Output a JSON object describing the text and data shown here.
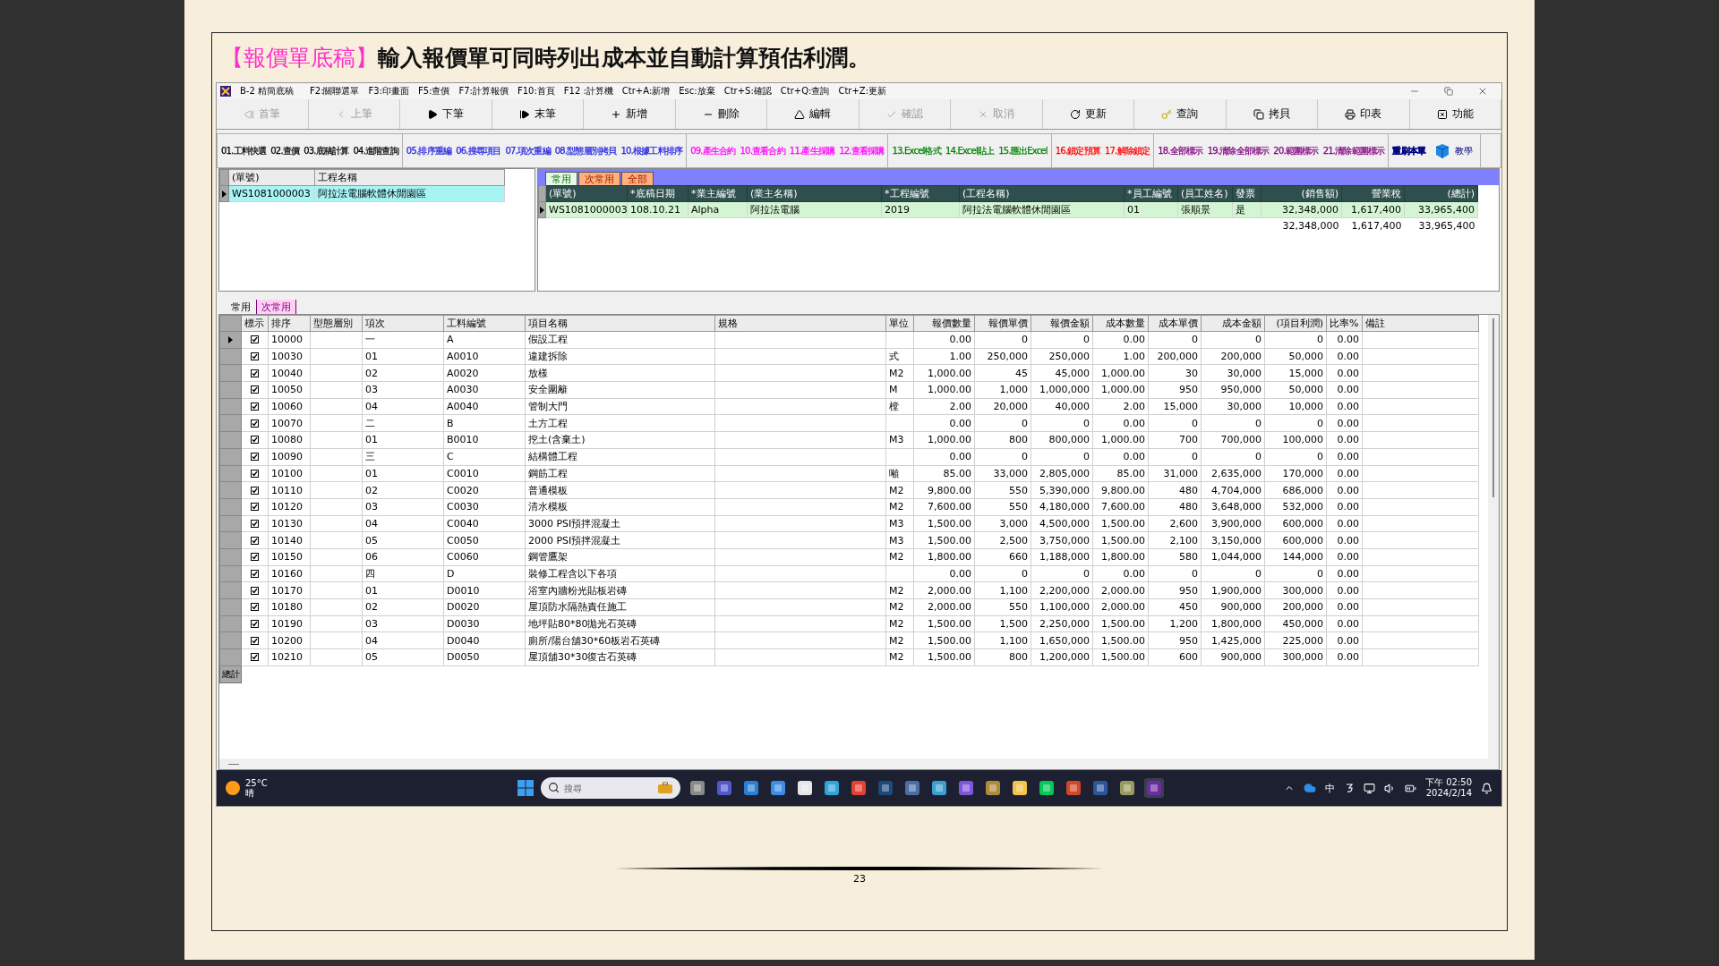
{
  "heading": {
    "tag": "【報價單底稿】",
    "text": "輸入報價單可同時列出成本並自動計算預估利潤。"
  },
  "window": {
    "title": "B-2 精簡底稿",
    "shortcuts": [
      "F2:關聯選單",
      "F3:印畫面",
      "F5:查價",
      "F7:計算報價",
      "F10:首頁",
      "F12 :計算機",
      "Ctr+A:新增",
      "Esc:放棄",
      "Ctr+S:確認",
      "Ctr+Q:查詢",
      "Ctr+Z:更新"
    ]
  },
  "toolbar": [
    {
      "label": "首筆",
      "disabled": true
    },
    {
      "label": "上筆",
      "disabled": true
    },
    {
      "label": "下筆",
      "disabled": false
    },
    {
      "label": "末筆",
      "disabled": false
    },
    {
      "label": "新增",
      "disabled": false
    },
    {
      "label": "刪除",
      "disabled": false
    },
    {
      "label": "編輯",
      "disabled": false
    },
    {
      "label": "確認",
      "disabled": true
    },
    {
      "label": "取消",
      "disabled": true
    },
    {
      "label": "更新",
      "disabled": false
    },
    {
      "label": "查詢",
      "disabled": false
    },
    {
      "label": "拷貝",
      "disabled": false
    },
    {
      "label": "印表",
      "disabled": false
    },
    {
      "label": "功能",
      "disabled": false
    }
  ],
  "function_groups": [
    {
      "color": "#000000",
      "items": [
        "01.工料快選",
        "02.查價",
        "03.底稿計算",
        "04.進階查詢"
      ]
    },
    {
      "color": "#1f1fe0",
      "items": [
        "05.排序重編",
        "06.搜尋項目",
        "07.項次重編",
        "08.型態層別拷貝",
        "10.根據工料排序"
      ]
    },
    {
      "color": "#ff00ff",
      "items": [
        "09.產生合約",
        "10.查看合約",
        "11.產生採購",
        "12.查看採購"
      ]
    },
    {
      "color": "#008000",
      "items": [
        "13.Excel格式",
        "14.Excel貼上",
        "15.匯出Excel"
      ]
    },
    {
      "color": "#ff0000",
      "items": [
        "16.鎖定預算",
        "17.解除鎖定"
      ]
    },
    {
      "color": "#800080",
      "items": [
        "18.全部標示",
        "19.清除全部標示",
        "20.範圍標示",
        "21.清除範圍標示"
      ]
    },
    {
      "color": "#000080",
      "items": [
        "重刷本單"
      ]
    }
  ],
  "tutorial_button": {
    "label": "教學"
  },
  "document_list": {
    "columns": [
      "(單號)",
      "工程名稱"
    ],
    "rows": [
      {
        "selected": true,
        "cells": [
          "WS1081000003",
          "阿拉法電腦軟體休閒園區"
        ]
      }
    ]
  },
  "detail_tabs": [
    {
      "label": "常用",
      "selected": true
    },
    {
      "label": "次常用",
      "selected": false
    },
    {
      "label": "全部",
      "selected": false
    }
  ],
  "detail_table": {
    "columns": [
      "(單號)",
      "*底稿日期",
      "*業主編號",
      "(業主名稱)",
      "*工程編號",
      "(工程名稱)",
      "*員工編號",
      "(員工姓名)",
      "發票",
      "(銷售額)",
      "營業稅",
      "(總計)"
    ],
    "rows": [
      {
        "current": true,
        "cells": [
          "WS1081000003",
          "108.10.21",
          "Alpha",
          "阿拉法電腦",
          "2019",
          "阿拉法電腦軟體休閒園區",
          "01",
          "張順景",
          "是",
          "32,348,000",
          "1,617,400",
          "33,965,400"
        ]
      }
    ],
    "totals": [
      "32,348,000",
      "1,617,400",
      "33,965,400"
    ]
  },
  "grid_tabs": [
    {
      "label": "常用",
      "selected": true
    },
    {
      "label": "次常用",
      "selected": false
    }
  ],
  "items_table": {
    "columns": [
      "標示",
      "排序",
      "型態層別",
      "項次",
      "工料編號",
      "項目名稱",
      "規格",
      "單位",
      "報價數量",
      "報價單價",
      "報價金額",
      "成本數量",
      "成本單價",
      "成本金額",
      "(項目利潤)",
      "比率%",
      "備註"
    ],
    "rows": [
      {
        "marked": true,
        "current": true,
        "sort": "10000",
        "item_no": "一",
        "code": "A",
        "name": "假設工程",
        "values": [
          "0.00",
          "0",
          "0",
          "0.00",
          "0",
          "0",
          "0",
          "0.00"
        ]
      },
      {
        "marked": true,
        "current": false,
        "sort": "10030",
        "item_no": "01",
        "code": "A0010",
        "name": "違建拆除",
        "unit": "式",
        "values": [
          "1.00",
          "250,000",
          "250,000",
          "1.00",
          "200,000",
          "200,000",
          "50,000",
          "0.00"
        ]
      },
      {
        "marked": true,
        "current": false,
        "sort": "10040",
        "item_no": "02",
        "code": "A0020",
        "name": "放樣",
        "unit": "M2",
        "values": [
          "1,000.00",
          "45",
          "45,000",
          "1,000.00",
          "30",
          "30,000",
          "15,000",
          "0.00"
        ]
      },
      {
        "marked": true,
        "current": false,
        "sort": "10050",
        "item_no": "03",
        "code": "A0030",
        "name": "安全圍籬",
        "unit": "M",
        "values": [
          "1,000.00",
          "1,000",
          "1,000,000",
          "1,000.00",
          "950",
          "950,000",
          "50,000",
          "0.00"
        ]
      },
      {
        "marked": true,
        "current": false,
        "sort": "10060",
        "item_no": "04",
        "code": "A0040",
        "name": "管制大門",
        "unit": "樘",
        "values": [
          "2.00",
          "20,000",
          "40,000",
          "2.00",
          "15,000",
          "30,000",
          "10,000",
          "0.00"
        ]
      },
      {
        "marked": true,
        "current": false,
        "sort": "10070",
        "item_no": "二",
        "code": "B",
        "name": "土方工程",
        "values": [
          "0.00",
          "0",
          "0",
          "0.00",
          "0",
          "0",
          "0",
          "0.00"
        ]
      },
      {
        "marked": true,
        "current": false,
        "sort": "10080",
        "item_no": "01",
        "code": "B0010",
        "name": "挖土(含棄土)",
        "unit": "M3",
        "values": [
          "1,000.00",
          "800",
          "800,000",
          "1,000.00",
          "700",
          "700,000",
          "100,000",
          "0.00"
        ]
      },
      {
        "marked": true,
        "current": false,
        "sort": "10090",
        "item_no": "三",
        "code": "C",
        "name": "結構體工程",
        "values": [
          "0.00",
          "0",
          "0",
          "0.00",
          "0",
          "0",
          "0",
          "0.00"
        ]
      },
      {
        "marked": true,
        "current": false,
        "sort": "10100",
        "item_no": "01",
        "code": "C0010",
        "name": "鋼筋工程",
        "unit": "噸",
        "values": [
          "85.00",
          "33,000",
          "2,805,000",
          "85.00",
          "31,000",
          "2,635,000",
          "170,000",
          "0.00"
        ]
      },
      {
        "marked": true,
        "current": false,
        "sort": "10110",
        "item_no": "02",
        "code": "C0020",
        "name": "普通模板",
        "unit": "M2",
        "values": [
          "9,800.00",
          "550",
          "5,390,000",
          "9,800.00",
          "480",
          "4,704,000",
          "686,000",
          "0.00"
        ]
      },
      {
        "marked": true,
        "current": false,
        "sort": "10120",
        "item_no": "03",
        "code": "C0030",
        "name": "清水模板",
        "unit": "M2",
        "values": [
          "7,600.00",
          "550",
          "4,180,000",
          "7,600.00",
          "480",
          "3,648,000",
          "532,000",
          "0.00"
        ]
      },
      {
        "marked": true,
        "current": false,
        "sort": "10130",
        "item_no": "04",
        "code": "C0040",
        "name": "3000 PSI預拌混凝土",
        "unit": "M3",
        "values": [
          "1,500.00",
          "3,000",
          "4,500,000",
          "1,500.00",
          "2,600",
          "3,900,000",
          "600,000",
          "0.00"
        ]
      },
      {
        "marked": true,
        "current": false,
        "sort": "10140",
        "item_no": "05",
        "code": "C0050",
        "name": "2000 PSI預拌混凝土",
        "unit": "M3",
        "values": [
          "1,500.00",
          "2,500",
          "3,750,000",
          "1,500.00",
          "2,100",
          "3,150,000",
          "600,000",
          "0.00"
        ]
      },
      {
        "marked": true,
        "current": false,
        "sort": "10150",
        "item_no": "06",
        "code": "C0060",
        "name": "鋼管鷹架",
        "unit": "M2",
        "values": [
          "1,800.00",
          "660",
          "1,188,000",
          "1,800.00",
          "580",
          "1,044,000",
          "144,000",
          "0.00"
        ]
      },
      {
        "marked": true,
        "current": false,
        "sort": "10160",
        "item_no": "四",
        "code": "D",
        "name": "裝修工程含以下各項",
        "values": [
          "0.00",
          "0",
          "0",
          "0.00",
          "0",
          "0",
          "0",
          "0.00"
        ]
      },
      {
        "marked": true,
        "current": false,
        "sort": "10170",
        "item_no": "01",
        "code": "D0010",
        "name": "浴室內牆粉光貼板岩磚",
        "unit": "M2",
        "values": [
          "2,000.00",
          "1,100",
          "2,200,000",
          "2,000.00",
          "950",
          "1,900,000",
          "300,000",
          "0.00"
        ]
      },
      {
        "marked": true,
        "current": false,
        "sort": "10180",
        "item_no": "02",
        "code": "D0020",
        "name": "屋頂防水隔熱責任施工",
        "unit": "M2",
        "values": [
          "2,000.00",
          "550",
          "1,100,000",
          "2,000.00",
          "450",
          "900,000",
          "200,000",
          "0.00"
        ]
      },
      {
        "marked": true,
        "current": false,
        "sort": "10190",
        "item_no": "03",
        "code": "D0030",
        "name": "地坪貼80*80拋光石英磚",
        "unit": "M2",
        "values": [
          "1,500.00",
          "1,500",
          "2,250,000",
          "1,500.00",
          "1,200",
          "1,800,000",
          "450,000",
          "0.00"
        ]
      },
      {
        "marked": true,
        "current": false,
        "sort": "10200",
        "item_no": "04",
        "code": "D0040",
        "name": "廁所/陽台舖30*60板岩石英磚",
        "unit": "M2",
        "values": [
          "1,500.00",
          "1,100",
          "1,650,000",
          "1,500.00",
          "950",
          "1,425,000",
          "225,000",
          "0.00"
        ]
      },
      {
        "marked": true,
        "current": false,
        "sort": "10210",
        "item_no": "05",
        "code": "D0050",
        "name": "屋頂舖30*30復古石英磚",
        "unit": "M2",
        "values": [
          "1,500.00",
          "800",
          "1,200,000",
          "1,500.00",
          "600",
          "900,000",
          "300,000",
          "0.00"
        ]
      }
    ],
    "footer_label": "總計"
  },
  "taskbar": {
    "temperature": "25°C",
    "weather": "晴",
    "search_placeholder": "搜尋",
    "ime": "中",
    "time": "下午 02:50",
    "date": "2024/2/14"
  },
  "page_number": "23"
}
